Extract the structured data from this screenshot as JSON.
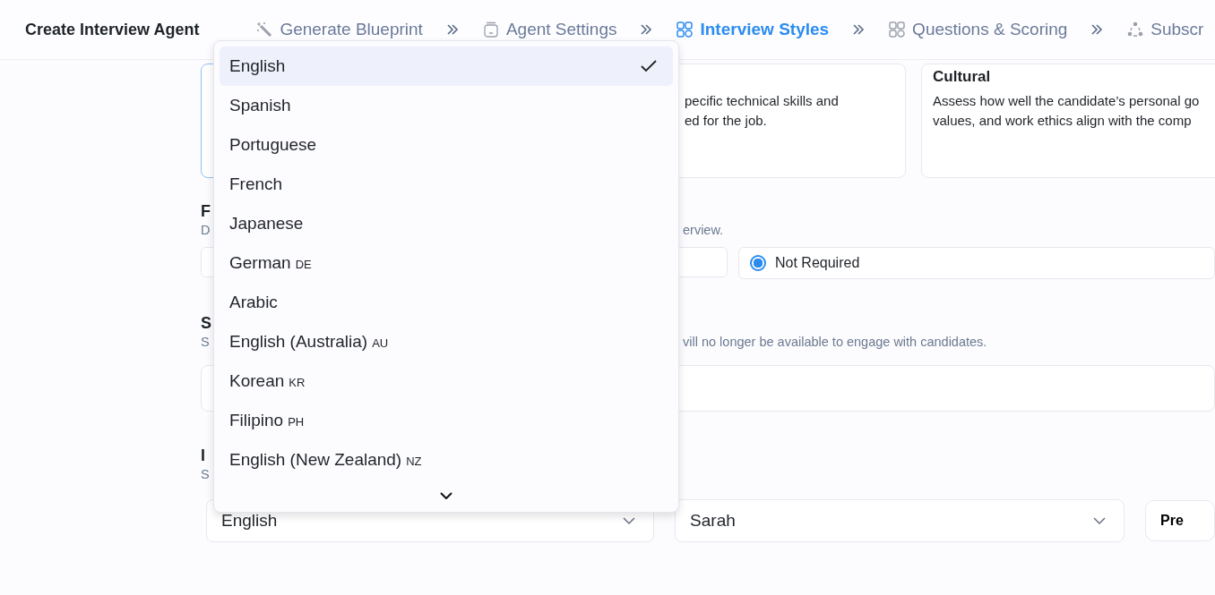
{
  "header": {
    "title": "Create Interview Agent",
    "steps": [
      {
        "label": "Generate Blueprint",
        "kind": "wand",
        "selected": false
      },
      {
        "label": "Agent Settings",
        "kind": "jar",
        "selected": false
      },
      {
        "label": "Interview Styles",
        "kind": "grid",
        "selected": true
      },
      {
        "label": "Questions & Scoring",
        "kind": "grid",
        "selected": false
      },
      {
        "label": "Subscr",
        "kind": "nodes",
        "selected": false
      }
    ]
  },
  "style_cards": [
    {
      "selected": true
    },
    {
      "selected": false,
      "lines": [
        "pecific technical skills and",
        "ed for the job."
      ]
    },
    {
      "selected": false,
      "title": "Cultural",
      "lines": [
        "Assess how well the candidate’s personal go",
        "values, and work ethics align with the comp"
      ]
    }
  ],
  "follow_up_section": {
    "heading": "F",
    "description_start": "D",
    "description_end": "erview.",
    "options": [
      {
        "label": "Not Required",
        "selected": true
      }
    ]
  },
  "schedule_section": {
    "heading": "S",
    "description_start": "S",
    "description_end": "vill no longer be available to engage with candidates."
  },
  "voice_section": {
    "heading": "I",
    "description_start": "S",
    "language": "English",
    "voice": "Sarah",
    "button": "Pre"
  },
  "language_dropdown": {
    "options": [
      {
        "label": "English",
        "selected": true
      },
      {
        "label": "Spanish",
        "selected": false
      },
      {
        "label": "Portuguese",
        "selected": false
      },
      {
        "label": "French",
        "selected": false
      },
      {
        "label": "Japanese",
        "selected": false
      },
      {
        "label": "German",
        "code": "DE",
        "selected": false
      },
      {
        "label": "Arabic",
        "selected": false
      },
      {
        "label": "English (Australia)",
        "code": "AU",
        "selected": false
      },
      {
        "label": "Korean",
        "code": "KR",
        "selected": false
      },
      {
        "label": "Filipino",
        "code": "PH",
        "selected": false
      },
      {
        "label": "English (New Zealand)",
        "code": "NZ",
        "selected": false
      }
    ]
  }
}
